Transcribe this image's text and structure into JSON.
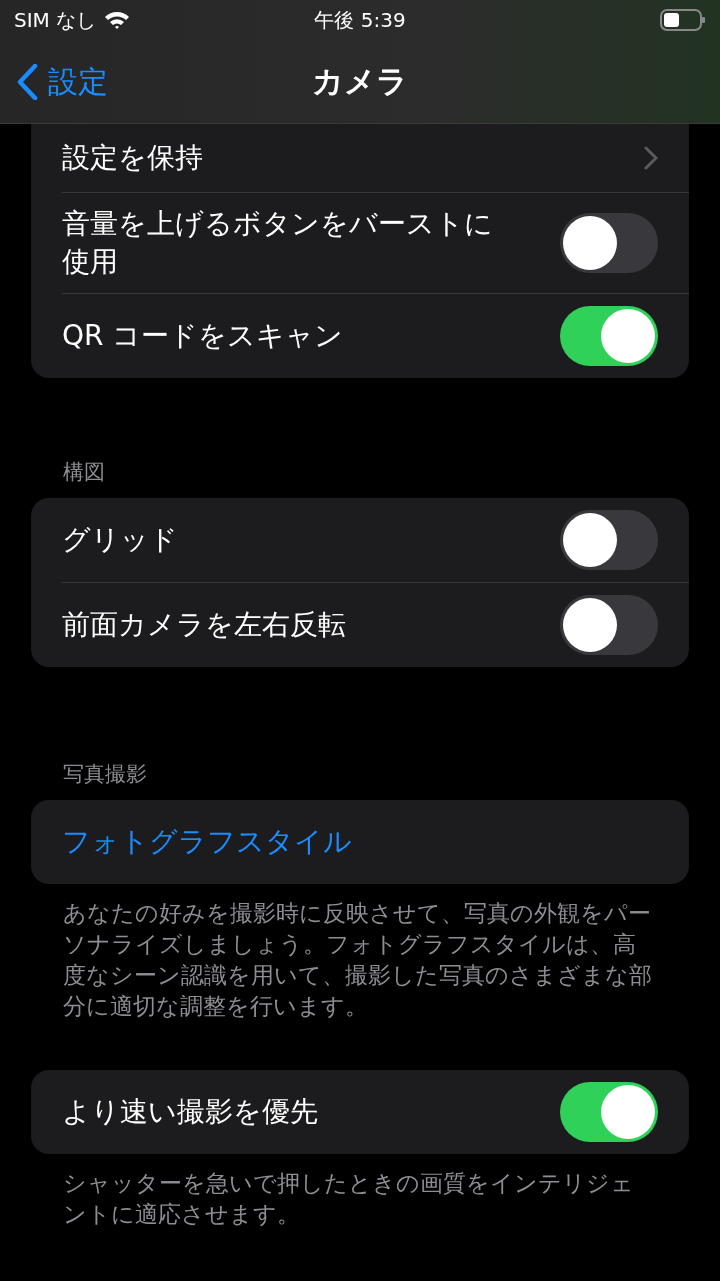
{
  "status_bar": {
    "carrier": "SIM なし",
    "time": "午後 5:39"
  },
  "nav": {
    "back_label": "設定",
    "title": "カメラ"
  },
  "sections": [
    {
      "rows": [
        {
          "kind": "link",
          "label": "設定を保持"
        },
        {
          "kind": "toggle",
          "label": "音量を上げるボタンをバーストに使用",
          "on": false
        },
        {
          "kind": "toggle",
          "label": "QR コードをスキャン",
          "on": true
        }
      ]
    },
    {
      "header": "構図",
      "rows": [
        {
          "kind": "toggle",
          "label": "グリッド",
          "on": false
        },
        {
          "kind": "toggle",
          "label": "前面カメラを左右反転",
          "on": false
        }
      ]
    },
    {
      "header": "写真撮影",
      "rows": [
        {
          "kind": "action",
          "label": "フォトグラフスタイル"
        }
      ],
      "footer": "あなたの好みを撮影時に反映させて、写真の外観をパーソナライズしましょう。フォトグラフスタイルは、高度なシーン認識を用いて、撮影した写真のさまざまな部分に適切な調整を行います。"
    },
    {
      "rows": [
        {
          "kind": "toggle",
          "label": "より速い撮影を優先",
          "on": true
        }
      ],
      "footer": "シャッターを急いで押したときの画質をインテリジェントに適応させます。"
    }
  ]
}
